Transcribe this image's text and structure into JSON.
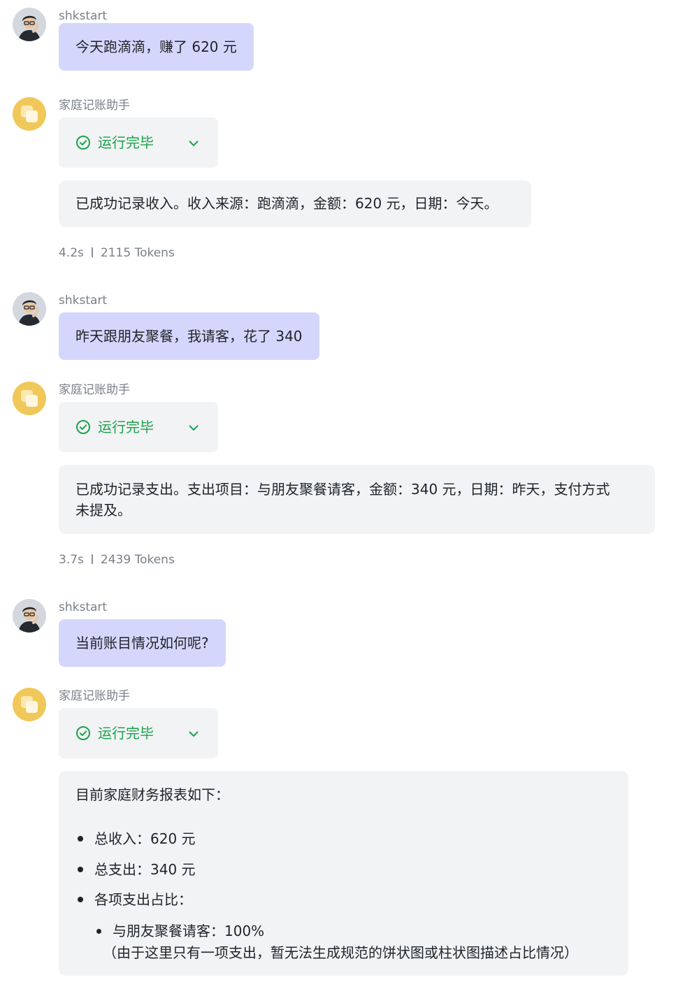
{
  "messages": [
    {
      "sender": "shkstart",
      "text": "今天跑滴滴，赚了 620 元"
    },
    {
      "sender": "家庭记账助手",
      "status": "运行完毕",
      "reply": "已成功记录收入。收入来源：跑滴滴，金额：620 元，日期：今天。",
      "time": "4.2s",
      "tokens": "2115 Tokens"
    },
    {
      "sender": "shkstart",
      "text": "昨天跟朋友聚餐，我请客，花了 340"
    },
    {
      "sender": "家庭记账助手",
      "status": "运行完毕",
      "reply_line1": "已成功记录支出。支出项目：与朋友聚餐请客，金额：340 元，日期：昨天，支付方式",
      "reply_line2": "未提及。",
      "time": "3.7s",
      "tokens": "2439 Tokens"
    },
    {
      "sender": "shkstart",
      "text": "当前账目情况如何呢?"
    },
    {
      "sender": "家庭记账助手",
      "status": "运行完毕",
      "report": {
        "intro": "目前家庭财务报表如下：",
        "items": [
          "总收入：620 元",
          "总支出：340 元",
          "各项支出占比："
        ],
        "sub_item": "与朋友聚餐请客：100%",
        "note": "（由于这里只有一项支出，暂无法生成规范的饼状图或柱状图描述占比情况）"
      }
    }
  ],
  "colors": {
    "user_bubble": "#d4d7fb",
    "reply_bg": "#f2f3f5",
    "status_green": "#1aa34a",
    "muted_text": "#7a7f88"
  },
  "icons": {
    "user_avatar": "user-avatar-icon",
    "bot_avatar": "assistant-avatar-icon",
    "status": "check-circle-icon",
    "expand": "chevron-down-icon"
  }
}
